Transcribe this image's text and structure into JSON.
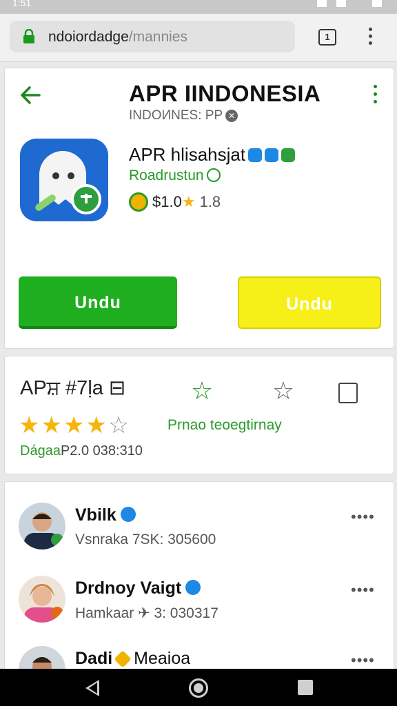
{
  "status_bar": {
    "time": "1:51"
  },
  "browser": {
    "url_main": "ndoiordadge",
    "url_rest": "/mannies",
    "tab_count": "1"
  },
  "app": {
    "header_title": "APR IINDONESIA",
    "header_subtitle": "INDOИNES: PP",
    "name": "APR hlisahsjat",
    "developer": "Roadrustun",
    "price": "$1.0",
    "rating_small": "1.8",
    "install_label": "Undu",
    "secondary_label": "Undu"
  },
  "rating": {
    "title": "APਸ਼ #7ḷa ⊟",
    "stars_filled": "★★★★",
    "stars_empty": "☆",
    "count_prefix": "Dágaa",
    "count_rest": "P2.0 038:310",
    "promo": "Prnao teoegtirnay"
  },
  "users": [
    {
      "name": "Vbilk",
      "meta": "Vsnraka 7SK: 305600"
    },
    {
      "name": "Drdnoy Vaigt",
      "meta": "Hamkaar ✈ 3: 030317"
    },
    {
      "name": "Dadi",
      "extra": "Meaioa",
      "meta": ""
    }
  ],
  "colors": {
    "accent_green": "#1fae1f",
    "accent_yellow": "#f6ef18",
    "badge_blue": "#1e88e5"
  }
}
